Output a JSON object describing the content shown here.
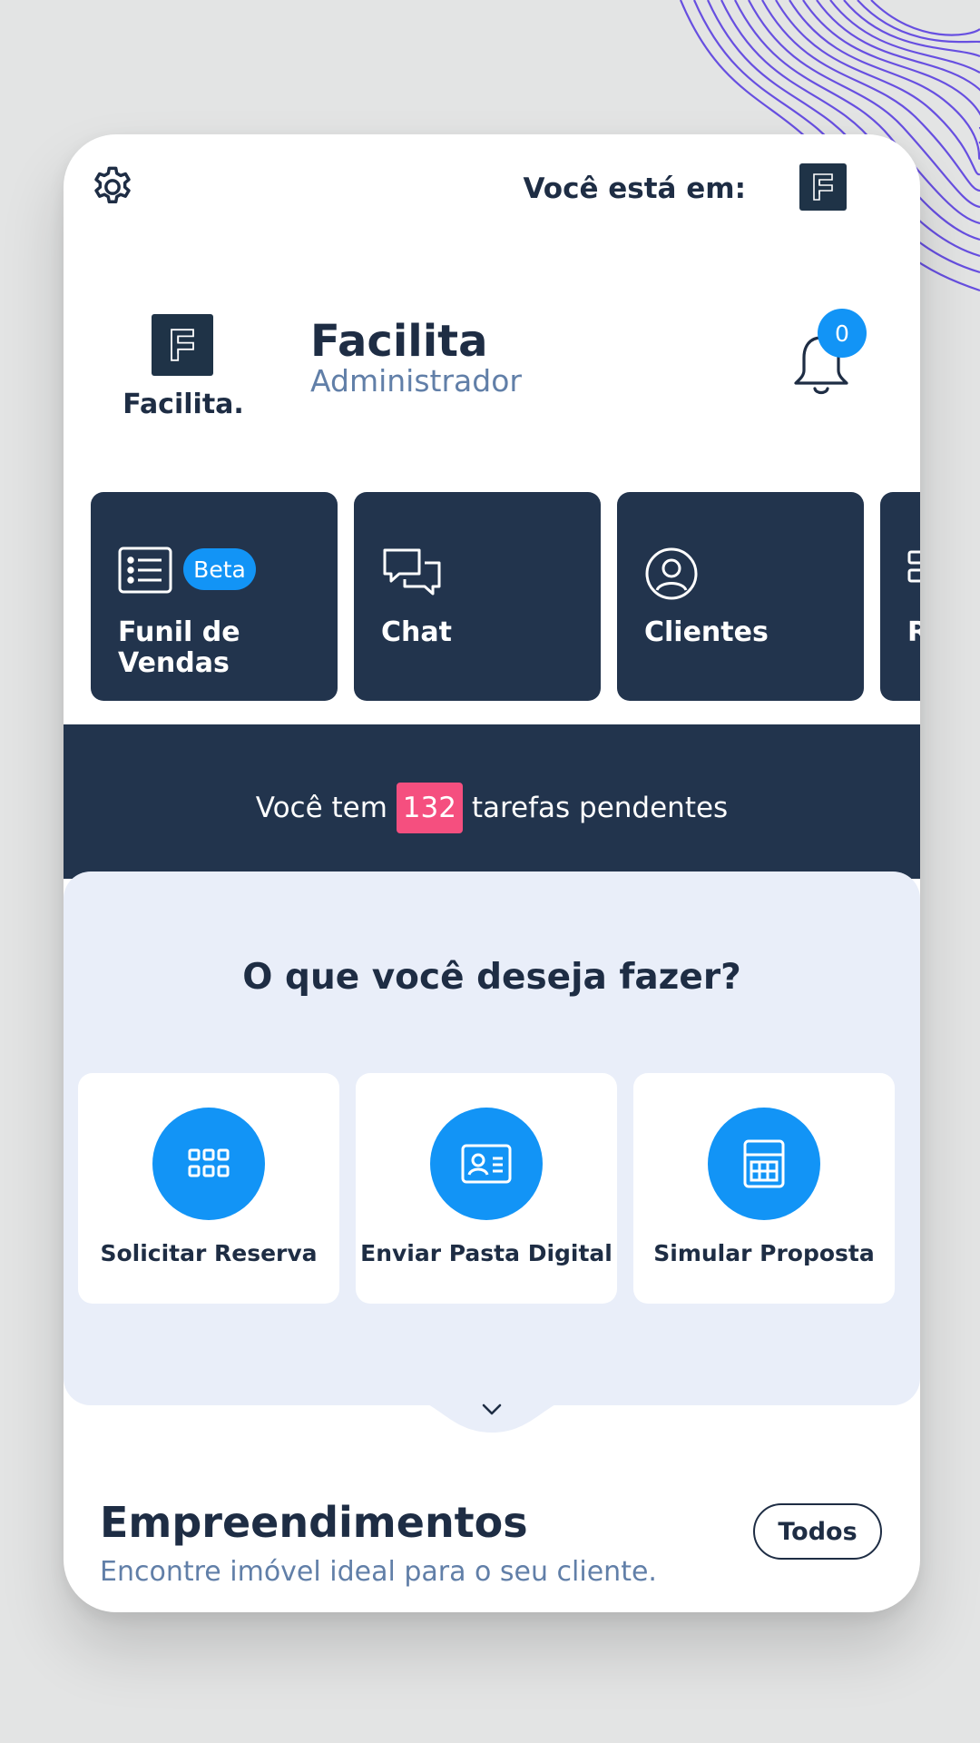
{
  "header": {
    "location_label": "Você está em:",
    "settings_icon": "gear-icon",
    "tenant_icon": "facilita-logo-icon"
  },
  "profile": {
    "brand_name": "Facilita.",
    "name": "Facilita",
    "role": "Administrador",
    "notifications_count": "0"
  },
  "modules": [
    {
      "label": "Funil de Vendas",
      "icon": "list-icon",
      "badge": "Beta"
    },
    {
      "label": "Chat",
      "icon": "chat-icon"
    },
    {
      "label": "Clientes",
      "icon": "user-circle-icon"
    },
    {
      "label": "R",
      "icon": "grid-icon"
    }
  ],
  "pending": {
    "prefix": "Você tem",
    "count": "132",
    "suffix": "tarefas pendentes"
  },
  "actions": {
    "title": "O que você deseja fazer?",
    "items": [
      {
        "label": "Solicitar Reserva",
        "icon": "grid-dots-icon"
      },
      {
        "label": "Enviar Pasta Digital",
        "icon": "id-card-icon"
      },
      {
        "label": "Simular Proposta",
        "icon": "calculator-icon"
      }
    ]
  },
  "empreendimentos": {
    "title": "Empreendimentos",
    "subtitle": "Encontre imóvel ideal para o seu cliente.",
    "button": "Todos"
  },
  "colors": {
    "navy": "#22344d",
    "accent_blue": "#1294f6",
    "badge_pink": "#f54f7f",
    "light_panel": "#e9eef9"
  }
}
